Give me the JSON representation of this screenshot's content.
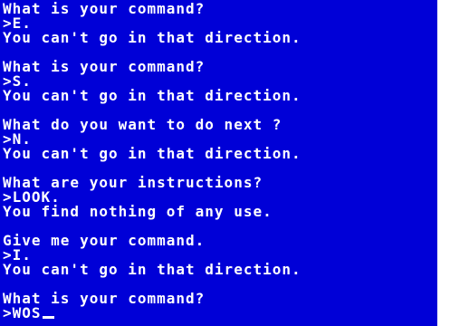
{
  "transcript": [
    {
      "prompt": "What is your command?",
      "input": ">E.",
      "response": "You can't go in that direction."
    },
    {
      "prompt": "What is your command?",
      "input": ">S.",
      "response": "You can't go in that direction."
    },
    {
      "prompt": "What do you want to do next ?",
      "input": ">N.",
      "response": "You can't go in that direction."
    },
    {
      "prompt": "What are your instructions?",
      "input": ">LOOK.",
      "response": "You find nothing of any use."
    },
    {
      "prompt": "Give me your command.",
      "input": ">I.",
      "response": "You can't go in that direction."
    }
  ],
  "current": {
    "prompt": "What is your command?",
    "input": ">WOS"
  },
  "colors": {
    "background": "#0000d7",
    "text": "#ffffff"
  }
}
